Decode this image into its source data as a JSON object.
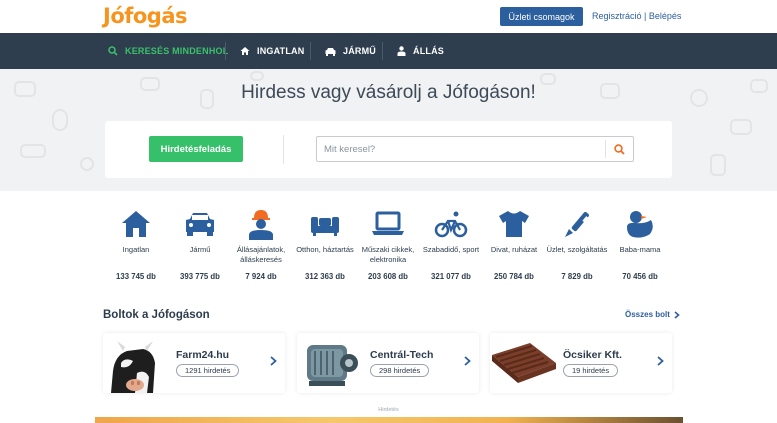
{
  "header": {
    "logo": "Jófogás",
    "business_button": "Üzleti csomagok",
    "auth_links": "Regisztráció | Belépés"
  },
  "nav": {
    "items": [
      {
        "label": "KERESÉS MINDENHOL",
        "icon": "search-icon",
        "active": true
      },
      {
        "label": "INGATLAN",
        "icon": "house-icon",
        "active": false
      },
      {
        "label": "JÁRMŰ",
        "icon": "car-icon",
        "active": false
      },
      {
        "label": "ÁLLÁS",
        "icon": "person-icon",
        "active": false
      }
    ]
  },
  "hero": {
    "title": "Hirdess vagy vásárolj a Jófogáson!",
    "post_button": "Hirdetésfeladás",
    "search_placeholder": "Mit keresel?"
  },
  "categories": [
    {
      "label": "Ingatlan",
      "count": "133 745 db",
      "icon": "house-icon"
    },
    {
      "label": "Jármű",
      "count": "393 775 db",
      "icon": "car-icon"
    },
    {
      "label": "Állásajánlatok, álláskeresés",
      "count": "7 924 db",
      "icon": "worker-icon"
    },
    {
      "label": "Otthon, háztartás",
      "count": "312 363 db",
      "icon": "sofa-icon"
    },
    {
      "label": "Műszaki cikkek, elektronika",
      "count": "203 608 db",
      "icon": "laptop-icon"
    },
    {
      "label": "Szabadidő, sport",
      "count": "321 077 db",
      "icon": "bicycle-icon"
    },
    {
      "label": "Divat, ruházat",
      "count": "250 784 db",
      "icon": "tshirt-icon"
    },
    {
      "label": "Üzlet, szolgáltatás",
      "count": "7 829 db",
      "icon": "tool-icon"
    },
    {
      "label": "Baba-mama",
      "count": "70 456 db",
      "icon": "duck-icon"
    }
  ],
  "shops": {
    "title": "Boltok a Jófogáson",
    "all_link": "Összes bolt",
    "items": [
      {
        "name": "Farm24.hu",
        "badge": "1291 hirdetés",
        "image": "cow-image"
      },
      {
        "name": "Centrál-Tech",
        "badge": "298 hirdetés",
        "image": "motor-image"
      },
      {
        "name": "Öcsiker Kft.",
        "badge": "19 hirdetés",
        "image": "roof-tiles-image"
      }
    ]
  },
  "ad": {
    "label": "Hirdetés"
  },
  "colors": {
    "brand_orange": "#f7941d",
    "nav_dark": "#2e3e4f",
    "accent_green": "#36c069",
    "link_blue": "#2c5f9e",
    "icon_blue": "#2c5f9e"
  }
}
